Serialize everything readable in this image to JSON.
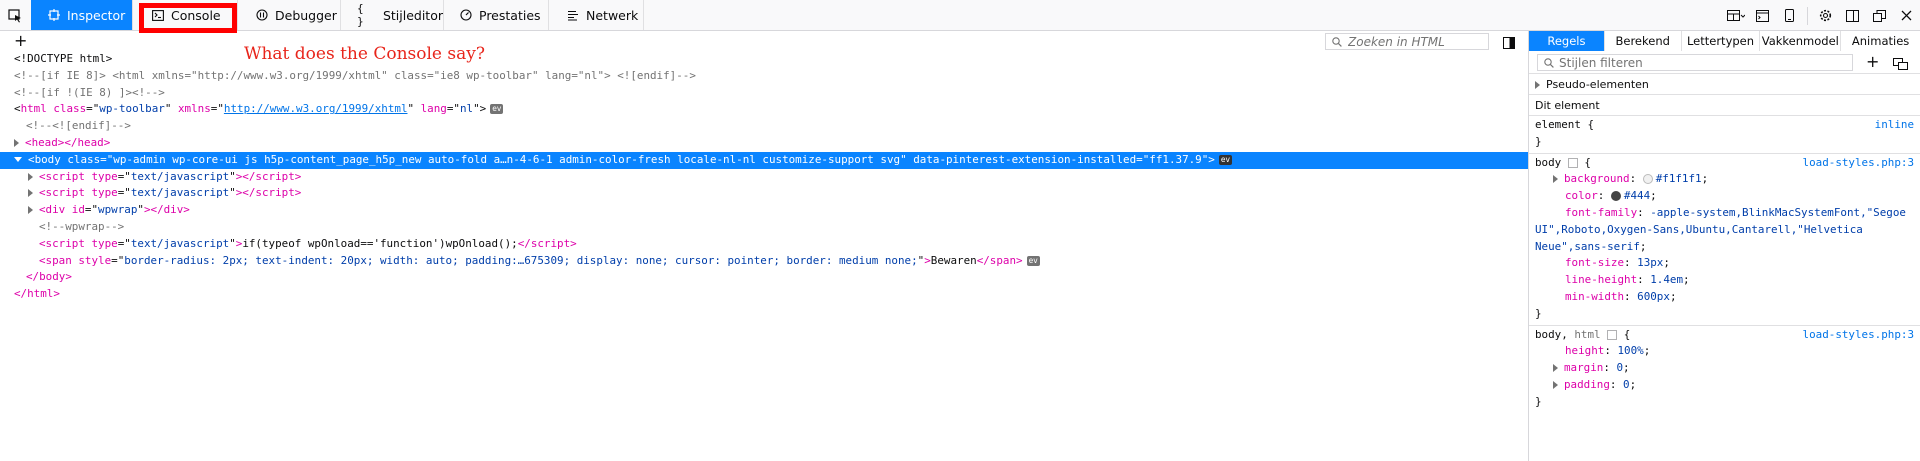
{
  "toolbar": {
    "tabs": [
      {
        "label": "Inspector",
        "icon": "inspector-icon",
        "active": true
      },
      {
        "label": "Console",
        "icon": "console-icon",
        "active": false
      },
      {
        "label": "Debugger",
        "icon": "debugger-icon",
        "active": false
      },
      {
        "label": "Stijleditor",
        "icon": "style-editor-icon",
        "active": false
      },
      {
        "label": "Prestaties",
        "icon": "performance-icon",
        "active": false
      },
      {
        "label": "Netwerk",
        "icon": "network-icon",
        "active": false
      }
    ],
    "accent": "#0a84ff"
  },
  "annotation": {
    "text": "What does the Console say?",
    "color": "#ff0000"
  },
  "markup": {
    "search_placeholder": "Zoeken in HTML",
    "lines": {
      "doctype": "<!DOCTYPE html>",
      "ie8": "<!--[if IE 8]> <html xmlns=\"http://www.w3.org/1999/xhtml\" class=\"ie8 wp-toolbar\" lang=\"nl\"> <![endif]-->",
      "notie8": "<!--[if !(IE 8) ]><!-->",
      "html_open": {
        "tag": "html",
        "class": "wp-toolbar",
        "xmlns": "http://www.w3.org/1999/xhtml",
        "lang": "nl"
      },
      "endif": "<!--<![endif]-->",
      "head": "head",
      "body": {
        "class": "wp-admin wp-core-ui js h5p-content_page_h5p_new auto-fold a…n-4-6-1 admin-color-fresh locale-nl-nl customize-support svg",
        "data_attr": "data-pinterest-extension-installed",
        "data_val": "ff1.37.9"
      },
      "script_type": "text/javascript",
      "div_id": "wpwrap",
      "wpwrap_comment": "<!--wpwrap-->",
      "inline_script": "if(typeof wpOnload=='function')wpOnload();",
      "span_style": "border-radius: 2px; text-indent: 20px; width: auto; padding:…675309; display: none; cursor: pointer; border: medium none;",
      "span_text": "Bewaren",
      "ev_label": "ev"
    }
  },
  "side": {
    "tabs": [
      "Regels",
      "Berekend",
      "Lettertypen",
      "Vakkenmodel",
      "Animaties"
    ],
    "filter_placeholder": "Stijlen filteren",
    "pseudo": "Pseudo-elementen",
    "this_element": "Dit element",
    "element_rule": {
      "selector": "element",
      "source": "inline"
    },
    "body_rule": {
      "selector": "body",
      "source": "load-styles.php:3",
      "props": [
        {
          "name": "background",
          "value": "#f1f1f1",
          "swatch": "#f1f1f1",
          "expand": true
        },
        {
          "name": "color",
          "value": "#444",
          "swatch": "#444444",
          "expand": false
        },
        {
          "name": "font-family",
          "value": "-apple-system,BlinkMacSystemFont,\"Segoe UI\",Roboto,Oxygen-Sans,Ubuntu,Cantarell,\"Helvetica Neue\",sans-serif",
          "expand": false
        },
        {
          "name": "font-size",
          "value": "13px",
          "expand": false
        },
        {
          "name": "line-height",
          "value": "1.4em",
          "expand": false
        },
        {
          "name": "min-width",
          "value": "600px",
          "expand": false
        }
      ]
    },
    "body_html_rule": {
      "selector_a": "body",
      "selector_b": "html",
      "source": "load-styles.php:3",
      "props": [
        {
          "name": "height",
          "value": "100%",
          "expand": false
        },
        {
          "name": "margin",
          "value": "0",
          "expand": true
        },
        {
          "name": "padding",
          "value": "0",
          "expand": true
        }
      ]
    }
  }
}
